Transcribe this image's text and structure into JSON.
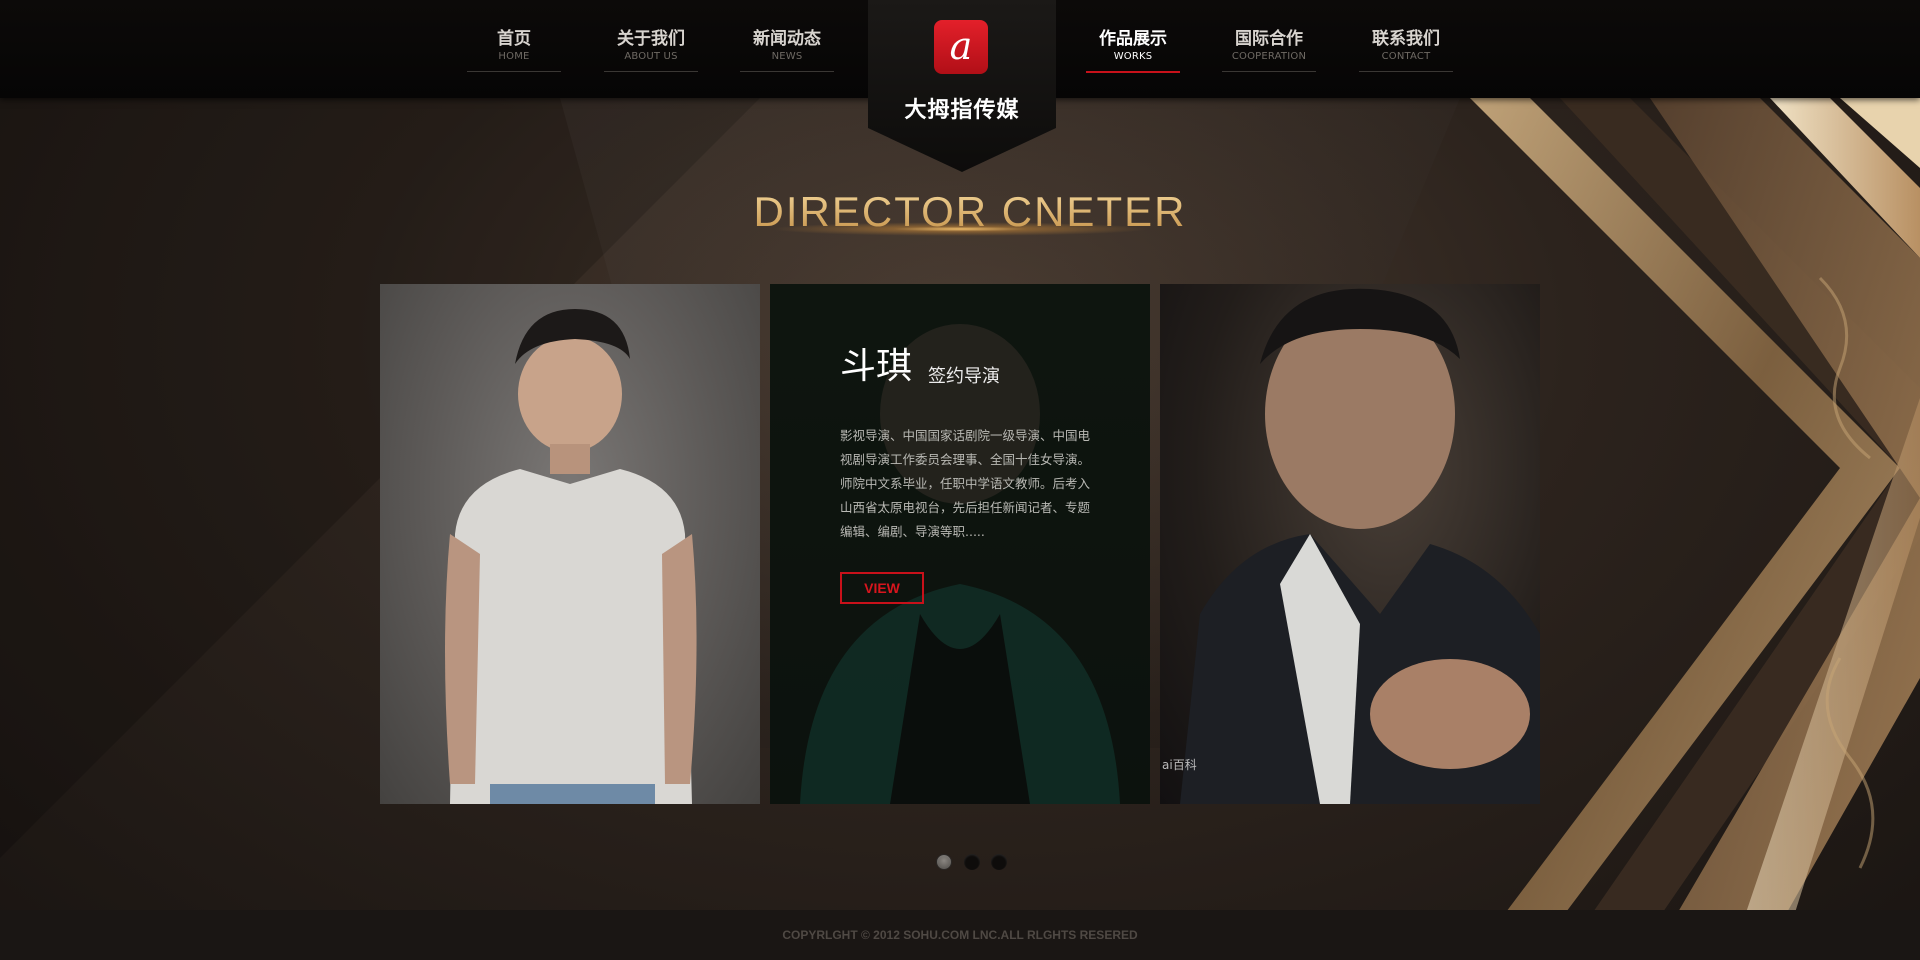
{
  "nav": {
    "left": [
      {
        "cn": "首页",
        "en": "HOME"
      },
      {
        "cn": "关于我们",
        "en": "ABOUT US"
      },
      {
        "cn": "新闻动态",
        "en": "NEWS"
      }
    ],
    "right": [
      {
        "cn": "作品展示",
        "en": "WORKS"
      },
      {
        "cn": "国际合作",
        "en": "COOPERATION"
      },
      {
        "cn": "联系我们",
        "en": "CONTACT"
      }
    ],
    "active": "WORKS"
  },
  "logo": {
    "icon_glyph": "a",
    "name": "大拇指传媒"
  },
  "section_title": "DIRECTOR CNETER",
  "director": {
    "name": "斗琪",
    "role": "签约导演",
    "description": "影视导演、中国国家话剧院一级导演、中国电视剧导演工作委员会理事、全国十佳女导演。师院中文系毕业，任职中学语文教师。后考入山西省太原电视台，先后担任新闻记者、专题编辑、编剧、导演等职.....",
    "button_label": "VIEW"
  },
  "watermark": "ai百科",
  "pager": {
    "total": 3,
    "current": 1
  },
  "footer": "COPYRLGHT © 2012 SOHU.COM LNC.ALL RLGHTS RESERED",
  "colors": {
    "accent": "#c8111a",
    "gold": "#e7c27c",
    "background": "#2a211b"
  }
}
